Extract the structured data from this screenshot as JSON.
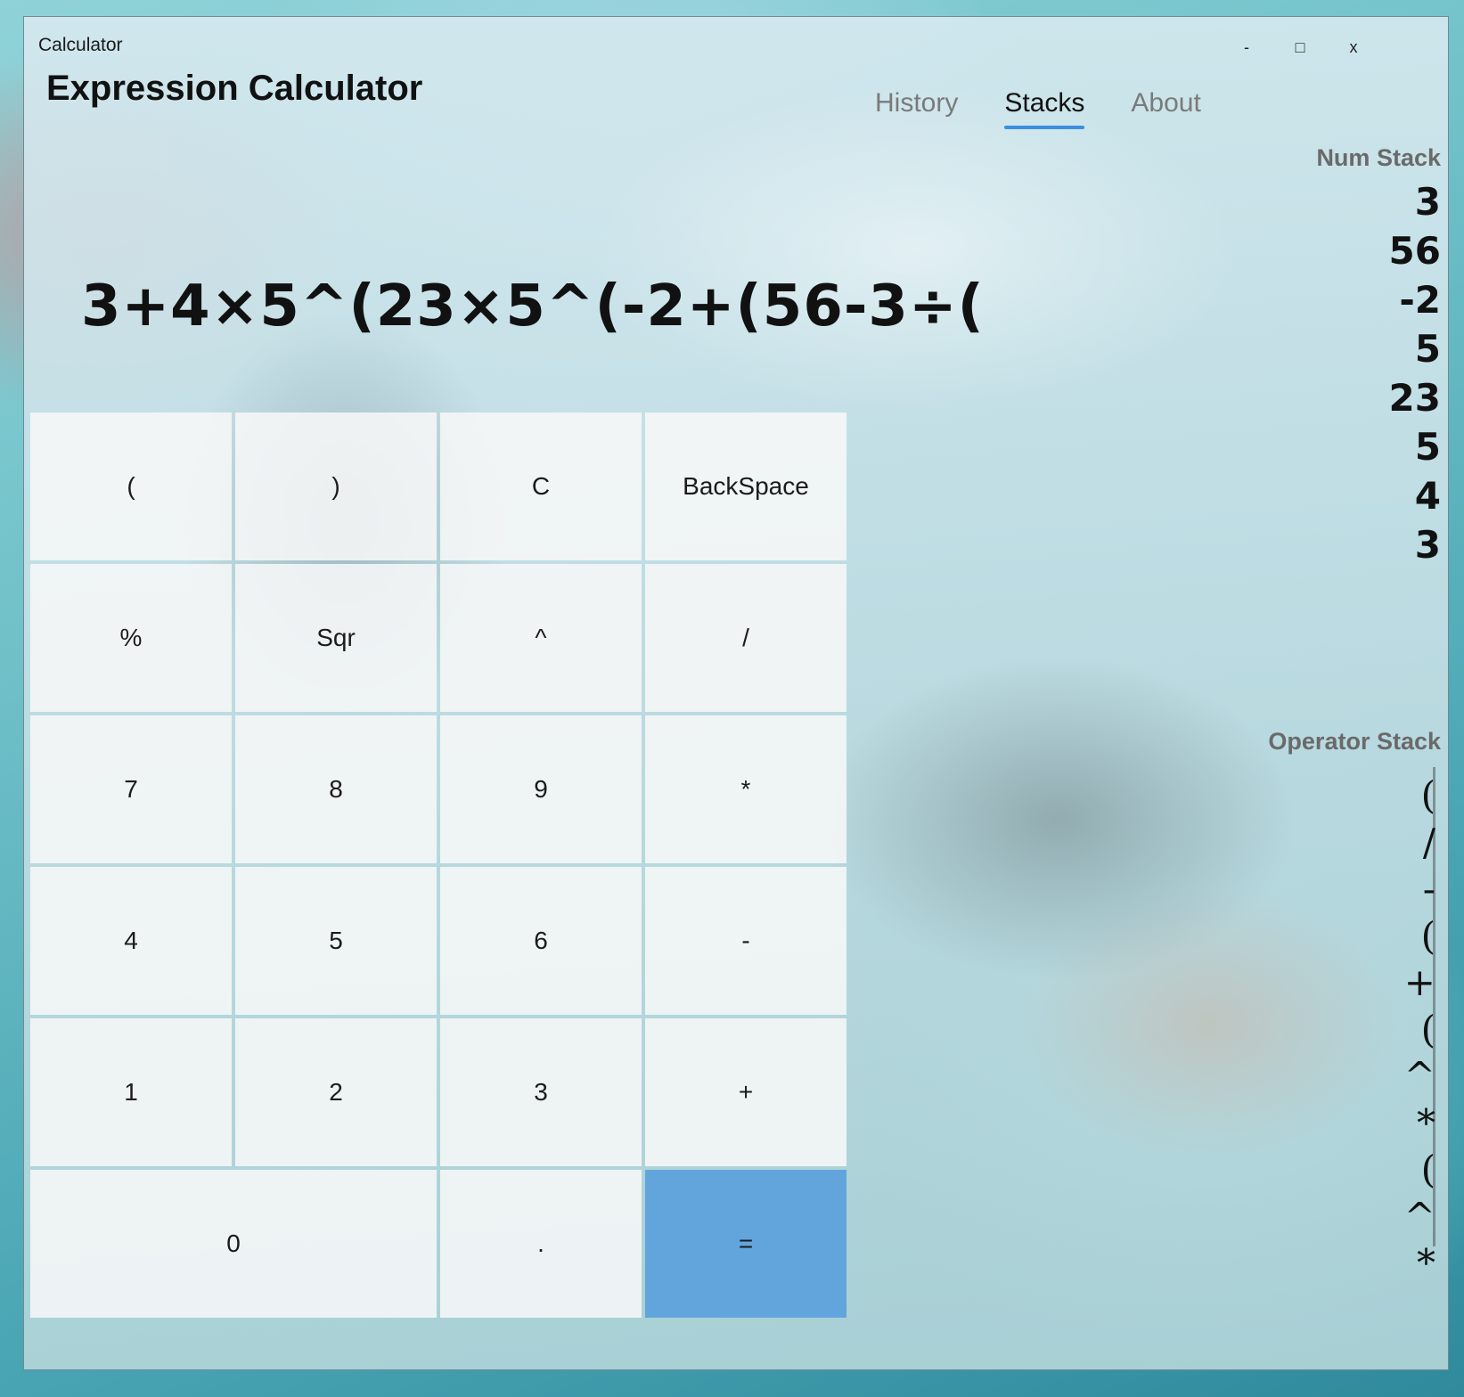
{
  "window": {
    "title": "Calculator",
    "minimize_label": "-",
    "maximize_label": "□",
    "close_label": "x"
  },
  "app_title": "Expression Calculator",
  "tabs": [
    {
      "label": "History",
      "active": false
    },
    {
      "label": "Stacks",
      "active": true
    },
    {
      "label": "About",
      "active": false
    }
  ],
  "expression": "3+4×5^(23×5^(-2+(56-3÷(",
  "keys": {
    "open_paren": "(",
    "close_paren": ")",
    "clear": "C",
    "backspace": "BackSpace",
    "percent": "%",
    "sqr": "Sqr",
    "power": "^",
    "divide": "/",
    "seven": "7",
    "eight": "8",
    "nine": "9",
    "multiply": "*",
    "four": "4",
    "five": "5",
    "six": "6",
    "minus": "-",
    "one": "1",
    "two": "2",
    "three": "3",
    "plus": "+",
    "zero": "0",
    "dot": ".",
    "equals": "="
  },
  "num_stack": {
    "title": "Num Stack",
    "items": [
      "3",
      "56",
      "-2",
      "5",
      "23",
      "5",
      "4",
      "3"
    ]
  },
  "operator_stack": {
    "title": "Operator Stack",
    "items": [
      "(",
      "/",
      "-",
      "(",
      "+",
      "(",
      "^",
      "*",
      "(",
      "^",
      "*"
    ]
  },
  "colors": {
    "accent": "#3a8fe0",
    "equals_button": "#62a5dc"
  }
}
